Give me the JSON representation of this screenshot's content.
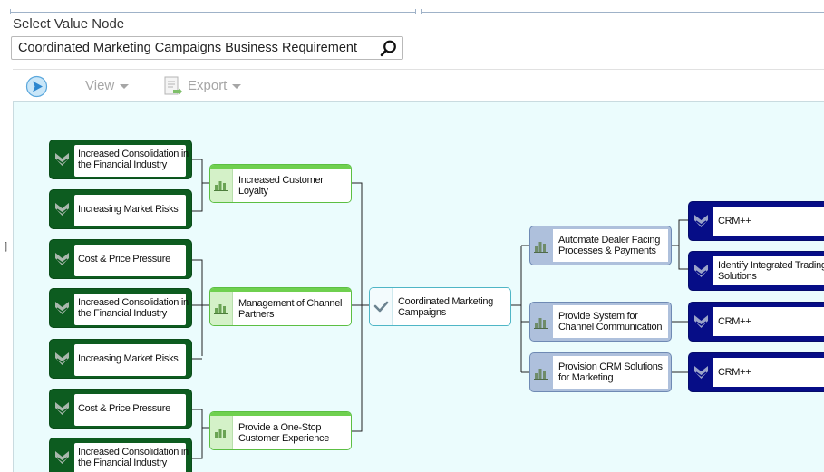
{
  "select_node": {
    "label": "Select Value Node",
    "search_value": "Coordinated Marketing Campaigns Business Requirement"
  },
  "toolbar": {
    "view_label": "View",
    "export_label": "Export"
  },
  "tree": {
    "root": {
      "label": "Coordinated Marketing Campaigns"
    },
    "left_groups": [
      {
        "label": "Increased Customer Loyalty",
        "drivers": [
          "Increased Consolidation in the Financial Industry",
          "Increasing Market Risks"
        ]
      },
      {
        "label": "Management of Channel Partners",
        "drivers": [
          "Cost & Price Pressure",
          "Increased Consolidation in the Financial Industry",
          "Increasing Market Risks"
        ]
      },
      {
        "label": "Provide a One-Stop Customer Experience",
        "drivers": [
          "Cost & Price Pressure",
          "Increased Consolidation in the Financial Industry"
        ]
      }
    ],
    "right_groups": [
      {
        "label": "Automate Dealer Facing Processes & Payments",
        "solutions": [
          "CRM++",
          "Identify Integrated Trading Solutions"
        ]
      },
      {
        "label": "Provide System for Channel Communication",
        "solutions": [
          "CRM++"
        ]
      },
      {
        "label": "Provision CRM Solutions for Marketing",
        "solutions": [
          "CRM++"
        ]
      }
    ]
  },
  "colors": {
    "driver_node": "#0d5c20",
    "goal_node": "#6fd04f",
    "root_node": "#4fb6c6",
    "process_node": "#aec0dc",
    "solution_node": "#060d87",
    "canvas_background": "#ebfcfd"
  },
  "icons": {
    "search": "search-icon",
    "go": "arrow-circle-icon",
    "export": "export-document-icon",
    "driver": "chevron-shield-icon",
    "goal": "bar-chart-icon",
    "root": "checkmark-icon",
    "solution": "chevron-shield-icon"
  }
}
